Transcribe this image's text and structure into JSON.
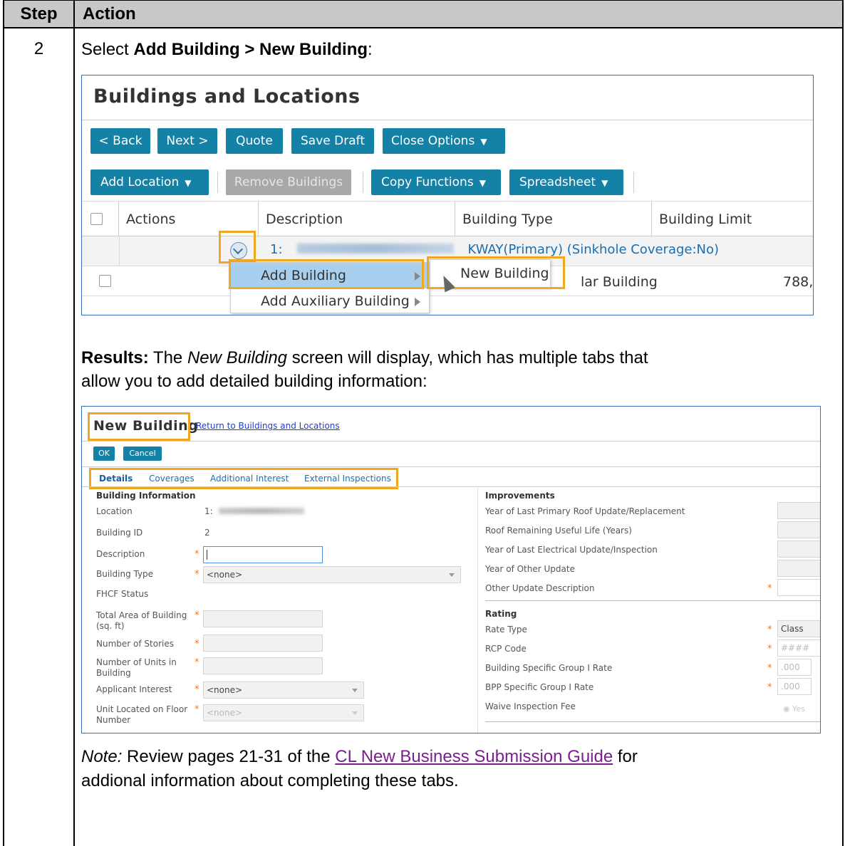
{
  "table": {
    "header_step": "Step",
    "header_action": "Action",
    "step_number": "2"
  },
  "intro": {
    "prefix": "Select ",
    "bold": "Add Building > New Building",
    "suffix": ":"
  },
  "screenshot1": {
    "title": "Buildings and Locations",
    "buttons_row1": [
      "< Back",
      "Next >",
      "Quote",
      "Save Draft",
      "Close Options"
    ],
    "buttons_row2": [
      "Add Location",
      "Remove Buildings",
      "Copy Functions",
      "Spreadsheet"
    ],
    "columns": [
      "Actions",
      "Description",
      "Building Type",
      "Building Limit"
    ],
    "location_row_prefix": "1:",
    "location_row_suffix": "KWAY(Primary) (Sinkhole Coverage:No)",
    "building_row_type_fragment": "lar Building",
    "building_row_limit_fragment": "788,",
    "menu_items": [
      "Add Building",
      "Add Auxiliary Building"
    ],
    "submenu_item": "New Building"
  },
  "results": {
    "label": "Results:",
    "text1": " The ",
    "italic": "New Building",
    "text2": " screen will display, which has multiple tabs that",
    "line2": "allow you to add detailed building information:"
  },
  "screenshot2": {
    "title": "New Building",
    "return_link": "Return to Buildings and Locations",
    "ok": "OK",
    "cancel": "Cancel",
    "tabs": [
      "Details",
      "Coverages",
      "Additional Interest",
      "External Inspections"
    ],
    "left_section": "Building Information",
    "location_label": "Location",
    "location_value": "1:",
    "building_id_label": "Building ID",
    "building_id_value": "2",
    "description_label": "Description",
    "building_type_label": "Building Type",
    "building_type_value": "<none>",
    "fhcf_label": "FHCF Status",
    "total_area_label_1": "Total Area of Building",
    "total_area_label_2": "(sq. ft)",
    "stories_label": "Number of Stories",
    "units_label_1": "Number of Units in",
    "units_label_2": "Building",
    "applicant_label": "Applicant Interest",
    "applicant_value": "<none>",
    "floor_label_1": "Unit Located on Floor",
    "floor_label_2": "Number",
    "floor_value": "<none>",
    "right_section1": "Improvements",
    "roof_update_label": "Year of Last Primary Roof Update/Replacement",
    "roof_life_label": "Roof Remaining Useful Life (Years)",
    "electrical_label": "Year of Last Electrical Update/Inspection",
    "other_update_label": "Year of Other Update",
    "other_desc_label": "Other Update Description",
    "right_section2": "Rating",
    "rate_type_label": "Rate Type",
    "rate_type_value": "Class",
    "rcp_label": "RCP Code",
    "rcp_value": "####",
    "bldg_rate_label": "Building Specific Group I Rate",
    "bldg_rate_value": ".000",
    "bpp_rate_label": "BPP Specific Group I Rate",
    "bpp_rate_value": ".000",
    "waive_label": "Waive Inspection Fee",
    "waive_value": "Yes",
    "required_mark": "*"
  },
  "note": {
    "label": "Note:",
    "text1": " Review pages 21-31 of the ",
    "link": "CL New Business Submission Guide",
    "text2": " for",
    "line2": "addional information about completing these tabs."
  },
  "colors": {
    "accent_button": "#1481a6",
    "highlight_box": "#f0a820",
    "frame_border": "#3b71b8",
    "link_purple": "#7b1f8e"
  }
}
